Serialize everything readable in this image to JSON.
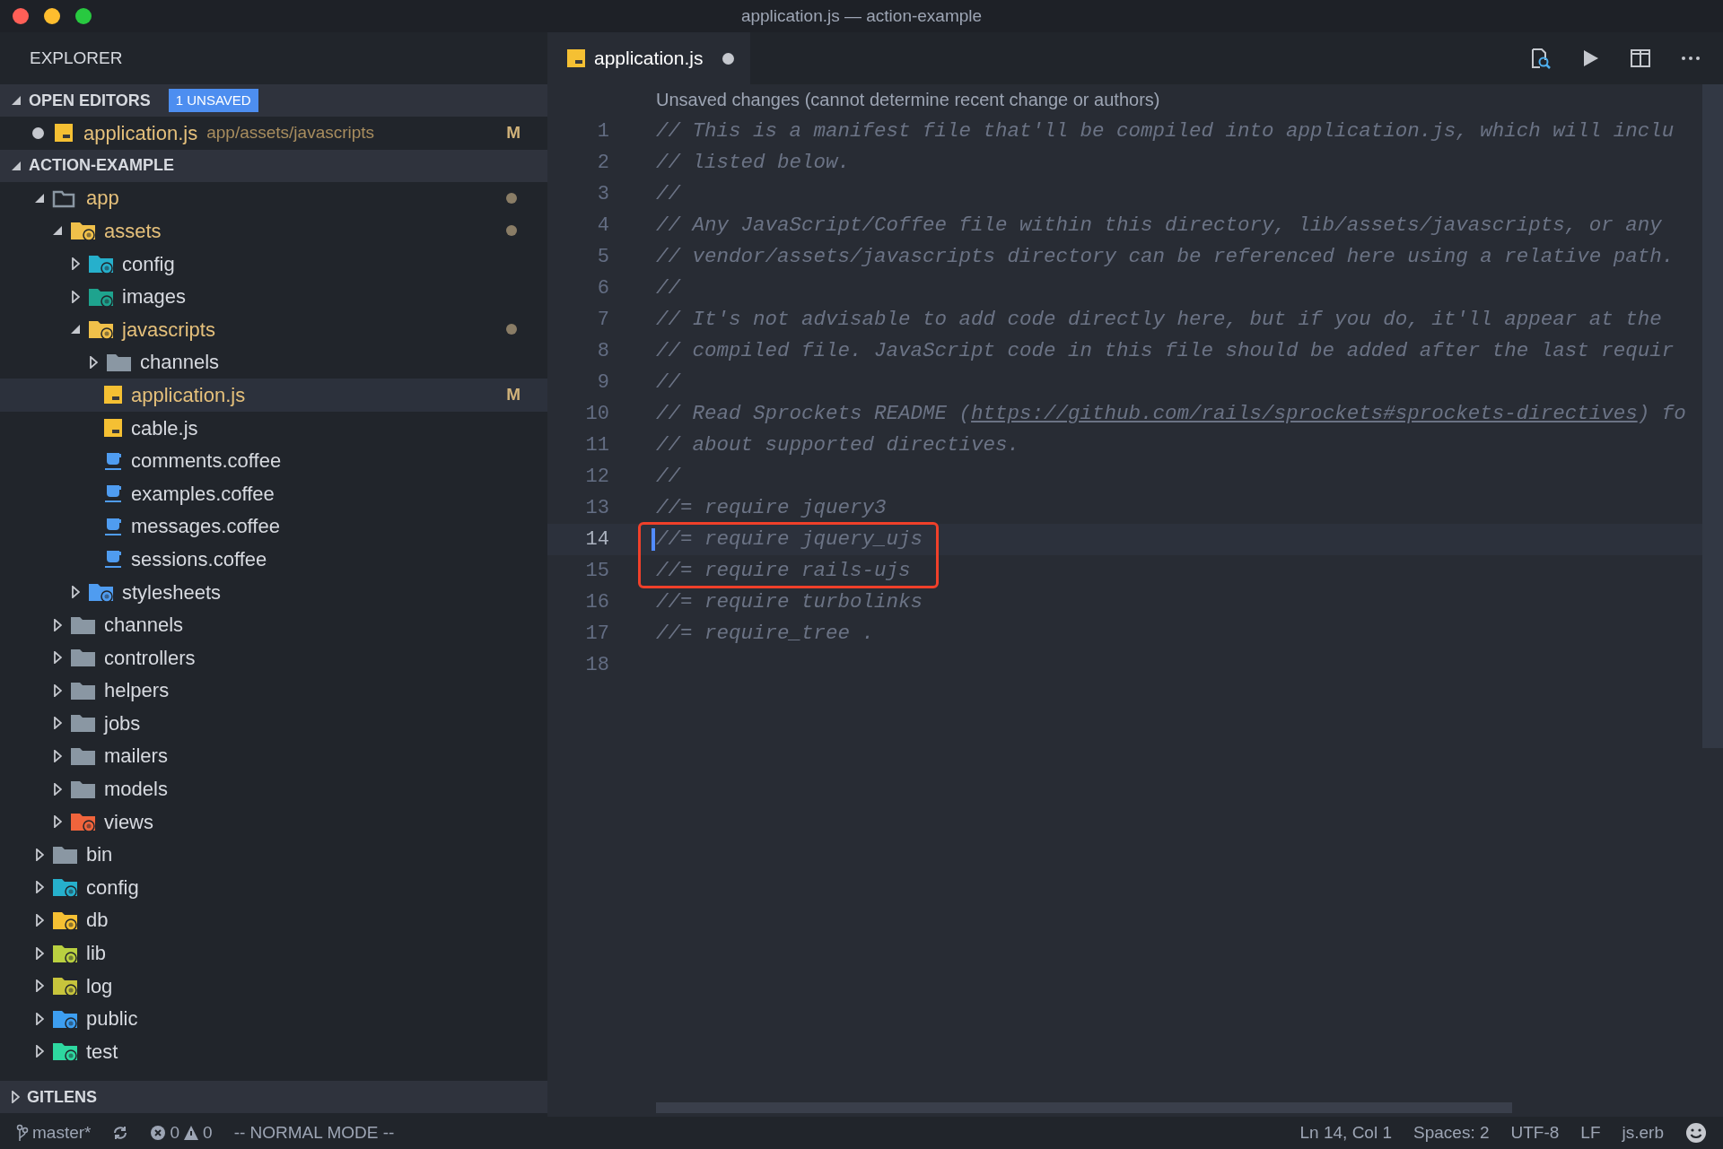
{
  "window": {
    "title": "application.js — action-example"
  },
  "sidebar": {
    "title": "EXPLORER",
    "open_editors": {
      "title": "OPEN EDITORS",
      "badge": "1 UNSAVED",
      "items": [
        {
          "name": "application.js",
          "path": "app/assets/javascripts",
          "kind": "js",
          "dirty": true,
          "modified": true,
          "badge": "M"
        }
      ]
    },
    "project": {
      "title": "ACTION-EXAMPLE",
      "expanded": true,
      "tree": [
        {
          "label": "app",
          "kind": "folder",
          "expanded": true,
          "modified": true,
          "dot": true,
          "selected": false,
          "children": [
            {
              "label": "assets",
              "kind": "assets",
              "expanded": true,
              "modified": true,
              "dot": true,
              "selected": false,
              "children": [
                {
                  "label": "config",
                  "kind": "config",
                  "expanded": false,
                  "modified": false,
                  "dot": false,
                  "selected": false
                },
                {
                  "label": "images",
                  "kind": "images",
                  "expanded": false,
                  "modified": false,
                  "dot": false,
                  "selected": false
                },
                {
                  "label": "javascripts",
                  "kind": "jsfolder",
                  "expanded": true,
                  "modified": true,
                  "dot": true,
                  "selected": false,
                  "children": [
                    {
                      "label": "channels",
                      "kind": "folder",
                      "expanded": false,
                      "modified": false,
                      "dot": false,
                      "selected": false
                    },
                    {
                      "label": "application.js",
                      "kind": "js",
                      "modified": true,
                      "dot": false,
                      "selected": true,
                      "badge": "M"
                    },
                    {
                      "label": "cable.js",
                      "kind": "js",
                      "modified": false,
                      "dot": false,
                      "selected": false
                    },
                    {
                      "label": "comments.coffee",
                      "kind": "coffee",
                      "modified": false,
                      "dot": false,
                      "selected": false
                    },
                    {
                      "label": "examples.coffee",
                      "kind": "coffee",
                      "modified": false,
                      "dot": false,
                      "selected": false
                    },
                    {
                      "label": "messages.coffee",
                      "kind": "coffee",
                      "modified": false,
                      "dot": false,
                      "selected": false
                    },
                    {
                      "label": "sessions.coffee",
                      "kind": "coffee",
                      "modified": false,
                      "dot": false,
                      "selected": false
                    }
                  ]
                },
                {
                  "label": "stylesheets",
                  "kind": "stylesheets",
                  "expanded": false,
                  "modified": false,
                  "dot": false,
                  "selected": false
                }
              ]
            },
            {
              "label": "channels",
              "kind": "folder",
              "expanded": false,
              "modified": false,
              "dot": false,
              "selected": false
            },
            {
              "label": "controllers",
              "kind": "folder",
              "expanded": false,
              "modified": false,
              "dot": false,
              "selected": false
            },
            {
              "label": "helpers",
              "kind": "folder",
              "expanded": false,
              "modified": false,
              "dot": false,
              "selected": false
            },
            {
              "label": "jobs",
              "kind": "folder",
              "expanded": false,
              "modified": false,
              "dot": false,
              "selected": false
            },
            {
              "label": "mailers",
              "kind": "folder",
              "expanded": false,
              "modified": false,
              "dot": false,
              "selected": false
            },
            {
              "label": "models",
              "kind": "folder",
              "expanded": false,
              "modified": false,
              "dot": false,
              "selected": false
            },
            {
              "label": "views",
              "kind": "views",
              "expanded": false,
              "modified": false,
              "dot": false,
              "selected": false
            }
          ]
        },
        {
          "label": "bin",
          "kind": "folder",
          "expanded": false,
          "modified": false,
          "dot": false,
          "selected": false
        },
        {
          "label": "config",
          "kind": "config",
          "expanded": false,
          "modified": false,
          "dot": false,
          "selected": false
        },
        {
          "label": "db",
          "kind": "db",
          "expanded": false,
          "modified": false,
          "dot": false,
          "selected": false
        },
        {
          "label": "lib",
          "kind": "lib",
          "expanded": false,
          "modified": false,
          "dot": false,
          "selected": false
        },
        {
          "label": "log",
          "kind": "log",
          "expanded": false,
          "modified": false,
          "dot": false,
          "selected": false
        },
        {
          "label": "public",
          "kind": "public",
          "expanded": false,
          "modified": false,
          "dot": false,
          "selected": false
        },
        {
          "label": "test",
          "kind": "test",
          "expanded": false,
          "modified": false,
          "dot": false,
          "selected": false
        }
      ]
    },
    "gitlens": {
      "title": "GITLENS",
      "expanded": false
    }
  },
  "editor": {
    "tabs": [
      {
        "label": "application.js",
        "kind": "js",
        "dirty": true,
        "selected": true
      }
    ],
    "codelens": "Unsaved changes (cannot determine recent change or authors)",
    "lines": [
      {
        "number": "1",
        "text": "// This is a manifest file that'll be compiled into application.js, which will inclu",
        "current": false,
        "boxed": false
      },
      {
        "number": "2",
        "text": "// listed below.",
        "current": false,
        "boxed": false
      },
      {
        "number": "3",
        "text": "//",
        "current": false,
        "boxed": false
      },
      {
        "number": "4",
        "text": "// Any JavaScript/Coffee file within this directory, lib/assets/javascripts, or any",
        "current": false,
        "boxed": false
      },
      {
        "number": "5",
        "text": "// vendor/assets/javascripts directory can be referenced here using a relative path.",
        "current": false,
        "boxed": false
      },
      {
        "number": "6",
        "text": "//",
        "current": false,
        "boxed": false
      },
      {
        "number": "7",
        "text": "// It's not advisable to add code directly here, but if you do, it'll appear at the",
        "current": false,
        "boxed": false
      },
      {
        "number": "8",
        "text": "// compiled file. JavaScript code in this file should be added after the last requir",
        "current": false,
        "boxed": false
      },
      {
        "number": "9",
        "text": "//",
        "current": false,
        "boxed": false
      },
      {
        "number": "10",
        "text": "// Read Sprockets README (",
        "link": "https://github.com/rails/sprockets#sprockets-directives",
        "after": ") fo",
        "current": false,
        "boxed": false
      },
      {
        "number": "11",
        "text": "// about supported directives.",
        "current": false,
        "boxed": false
      },
      {
        "number": "12",
        "text": "//",
        "current": false,
        "boxed": false
      },
      {
        "number": "13",
        "text": "//= require jquery3",
        "current": false,
        "boxed": false
      },
      {
        "number": "14",
        "text": "//= require jquery_ujs",
        "current": true,
        "boxed": true
      },
      {
        "number": "15",
        "text": "//= require rails-ujs",
        "current": false,
        "boxed": true
      },
      {
        "number": "16",
        "text": "//= require turbolinks",
        "current": false,
        "boxed": false
      },
      {
        "number": "17",
        "text": "//= require_tree .",
        "current": false,
        "boxed": false
      },
      {
        "number": "18",
        "current": false,
        "boxed": false
      }
    ]
  },
  "status_bar": {
    "branch": "master*",
    "errors": "0",
    "warnings": "0",
    "mode": "-- NORMAL MODE --",
    "right": [
      "Ln 14, Col 1",
      "Spaces: 2",
      "UTF-8",
      "LF",
      "js.erb"
    ]
  }
}
